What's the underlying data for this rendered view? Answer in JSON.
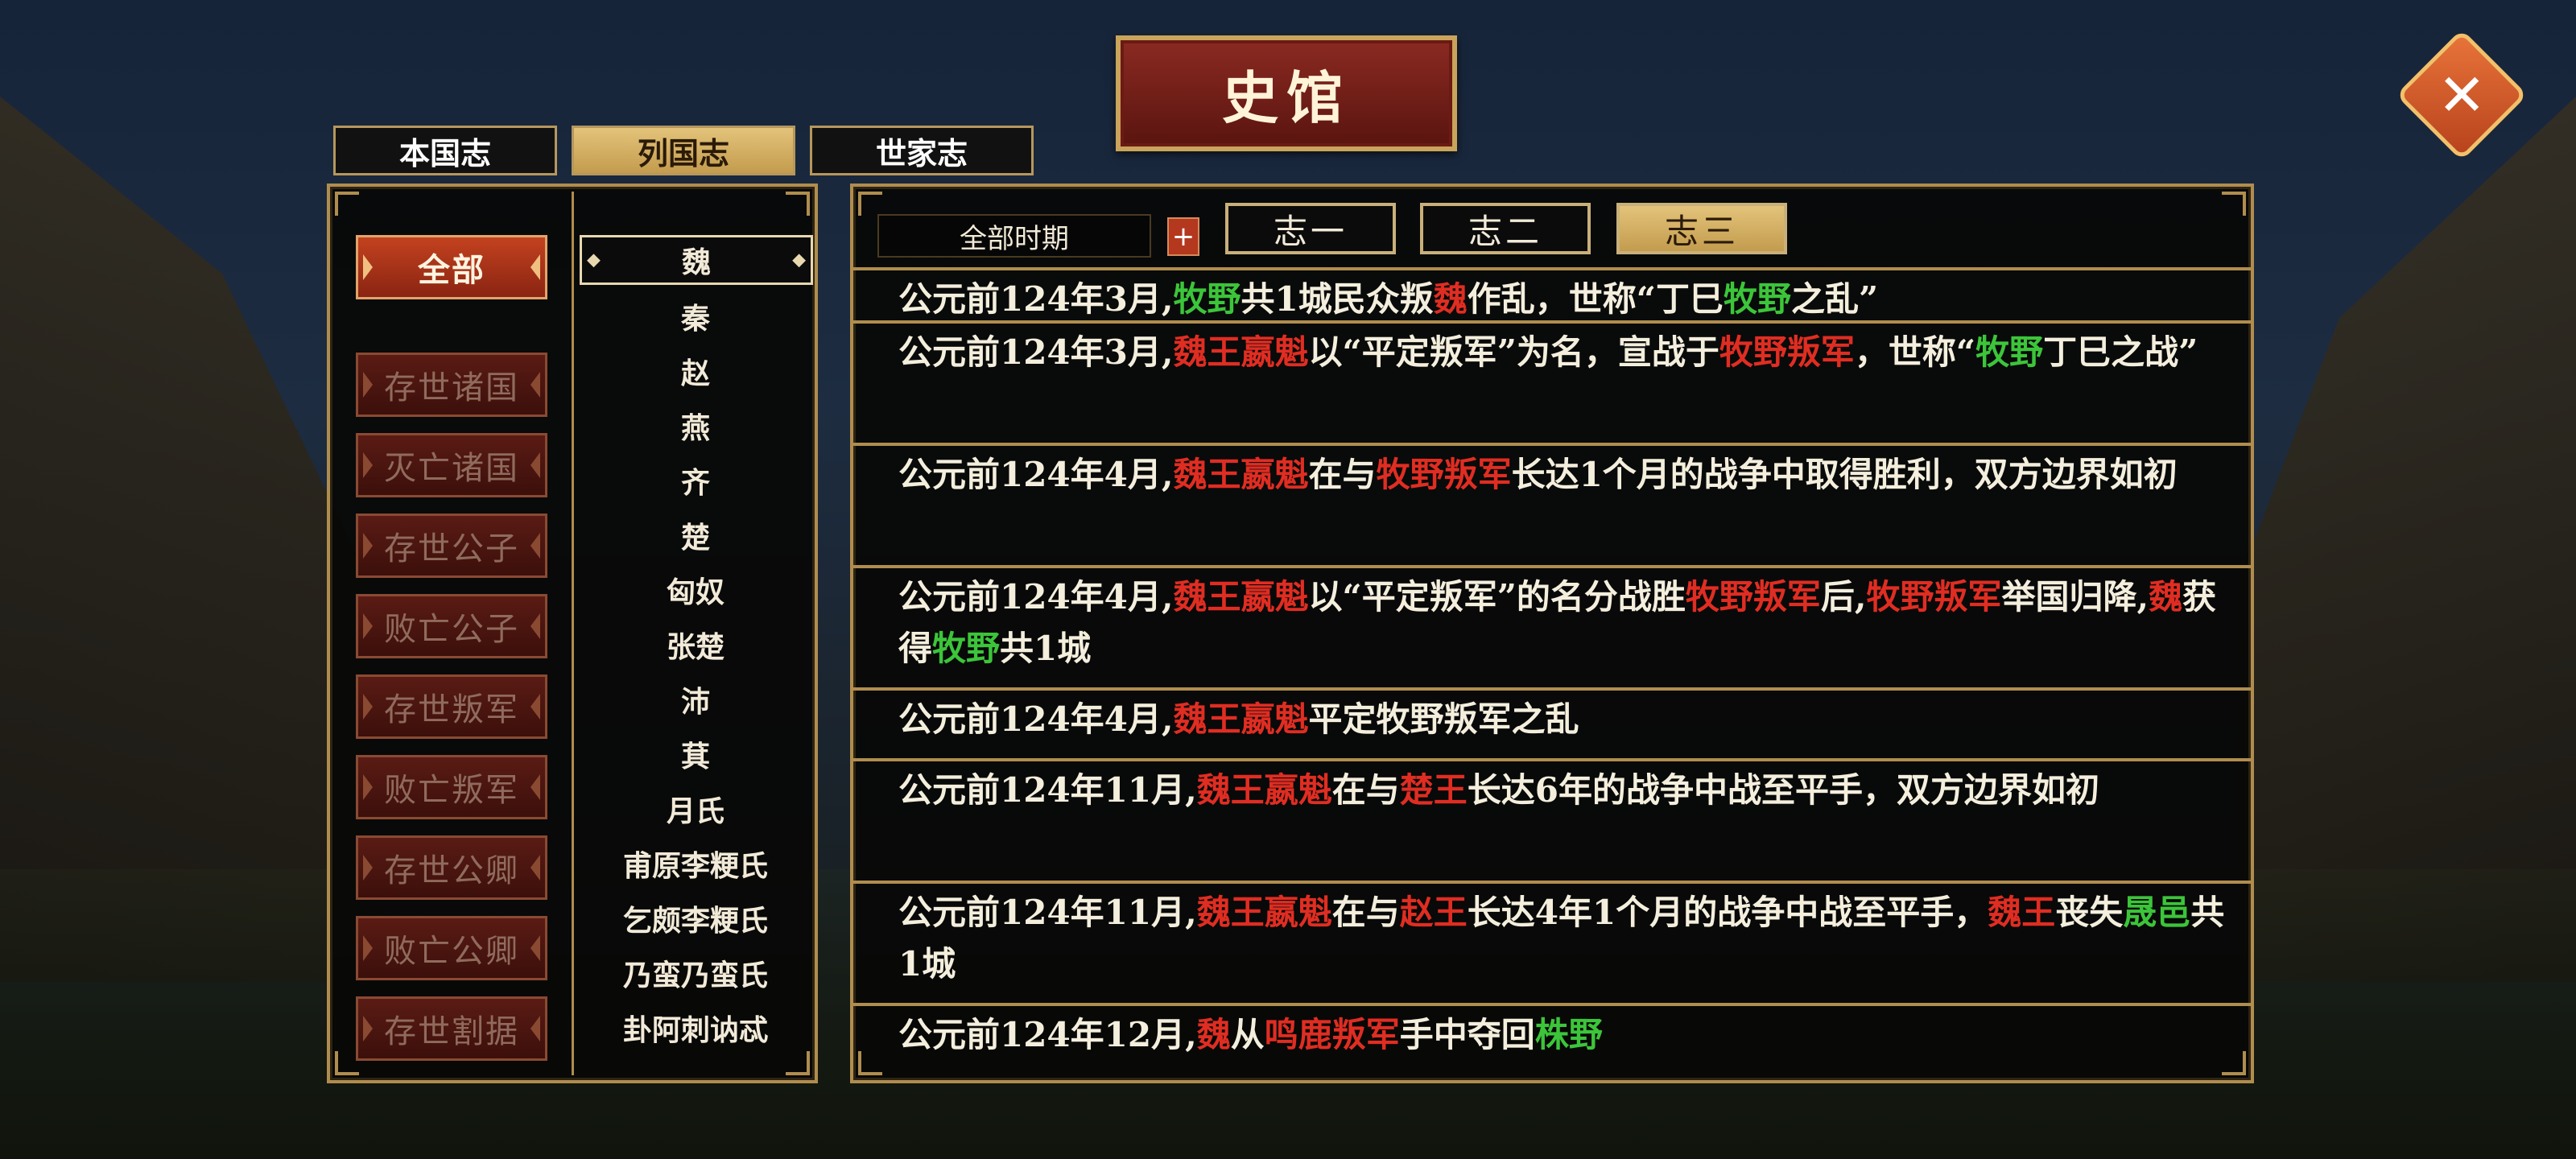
{
  "header": {
    "title": "史馆",
    "close_label": "✕"
  },
  "top_tabs": [
    {
      "label": "本国志",
      "active": false
    },
    {
      "label": "列国志",
      "active": true
    },
    {
      "label": "世家志",
      "active": false
    }
  ],
  "categories": [
    {
      "label": "全部",
      "active": true
    },
    {
      "label": "存世诸国",
      "active": false
    },
    {
      "label": "灭亡诸国",
      "active": false
    },
    {
      "label": "存世公子",
      "active": false
    },
    {
      "label": "败亡公子",
      "active": false
    },
    {
      "label": "存世叛军",
      "active": false
    },
    {
      "label": "败亡叛军",
      "active": false
    },
    {
      "label": "存世公卿",
      "active": false
    },
    {
      "label": "败亡公卿",
      "active": false
    },
    {
      "label": "存世割据",
      "active": false
    }
  ],
  "states": [
    {
      "label": "魏",
      "active": true
    },
    {
      "label": "秦"
    },
    {
      "label": "赵"
    },
    {
      "label": "燕"
    },
    {
      "label": "齐"
    },
    {
      "label": "楚"
    },
    {
      "label": "匈奴"
    },
    {
      "label": "张楚"
    },
    {
      "label": "沛"
    },
    {
      "label": "萁"
    },
    {
      "label": "月氏"
    },
    {
      "label": "甫原李粳氏"
    },
    {
      "label": "乞颇李粳氏"
    },
    {
      "label": "乃蛮乃蛮氏"
    },
    {
      "label": "卦阿刺讷忒"
    }
  ],
  "filter": {
    "period": "全部时期",
    "plus": "+"
  },
  "volume_tabs": [
    {
      "label": "志一",
      "active": false
    },
    {
      "label": "志二",
      "active": false
    },
    {
      "label": "志三",
      "active": true
    }
  ],
  "entries": [
    {
      "segments": [
        {
          "t": "公元前124年3月,"
        },
        {
          "t": "牧野",
          "c": "g"
        },
        {
          "t": "共1城民众叛"
        },
        {
          "t": "魏",
          "c": "r"
        },
        {
          "t": "作乱，世称“丁巳"
        },
        {
          "t": "牧野",
          "c": "g"
        },
        {
          "t": "之乱”"
        }
      ]
    },
    {
      "segments": [
        {
          "t": "公元前124年3月,"
        },
        {
          "t": "魏王嬴魁",
          "c": "r"
        },
        {
          "t": "以“平定叛军”为名，宣战于"
        },
        {
          "t": "牧野叛军",
          "c": "r"
        },
        {
          "t": "，世称“"
        },
        {
          "t": "牧野",
          "c": "g"
        },
        {
          "t": "丁巳之战”"
        }
      ]
    },
    {
      "segments": [
        {
          "t": "公元前124年4月,"
        },
        {
          "t": "魏王嬴魁",
          "c": "r"
        },
        {
          "t": "在与"
        },
        {
          "t": "牧野叛军",
          "c": "r"
        },
        {
          "t": "长达1个月的战争中取得胜利，双方边界如初"
        }
      ]
    },
    {
      "segments": [
        {
          "t": "公元前124年4月,"
        },
        {
          "t": "魏王嬴魁",
          "c": "r"
        },
        {
          "t": "以“平定叛军”的名分战胜"
        },
        {
          "t": "牧野叛军",
          "c": "r"
        },
        {
          "t": "后,"
        },
        {
          "t": "牧野叛军",
          "c": "r"
        },
        {
          "t": "举国归降,"
        },
        {
          "t": "魏",
          "c": "r"
        },
        {
          "t": "获得"
        },
        {
          "t": "牧野",
          "c": "g"
        },
        {
          "t": "共1城"
        }
      ]
    },
    {
      "segments": [
        {
          "t": "公元前124年4月,"
        },
        {
          "t": "魏王嬴魁",
          "c": "r"
        },
        {
          "t": "平定牧野叛军之乱"
        }
      ]
    },
    {
      "segments": [
        {
          "t": "公元前124年11月,"
        },
        {
          "t": "魏王嬴魁",
          "c": "r"
        },
        {
          "t": "在与"
        },
        {
          "t": "楚王",
          "c": "r"
        },
        {
          "t": "长达6年的战争中战至平手，双方边界如初"
        }
      ]
    },
    {
      "segments": [
        {
          "t": "公元前124年11月,"
        },
        {
          "t": "魏王嬴魁",
          "c": "r"
        },
        {
          "t": "在与"
        },
        {
          "t": "赵王",
          "c": "r"
        },
        {
          "t": "长达4年1个月的战争中战至平手，"
        },
        {
          "t": "魏王",
          "c": "r"
        },
        {
          "t": "丧失"
        },
        {
          "t": "晟邑",
          "c": "g"
        },
        {
          "t": "共1城"
        }
      ]
    },
    {
      "segments": [
        {
          "t": "公元前124年12月,"
        },
        {
          "t": "魏",
          "c": "r"
        },
        {
          "t": "从"
        },
        {
          "t": "鸣鹿叛军",
          "c": "r"
        },
        {
          "t": "手中夺回"
        },
        {
          "t": "株野",
          "c": "g"
        }
      ]
    }
  ]
}
